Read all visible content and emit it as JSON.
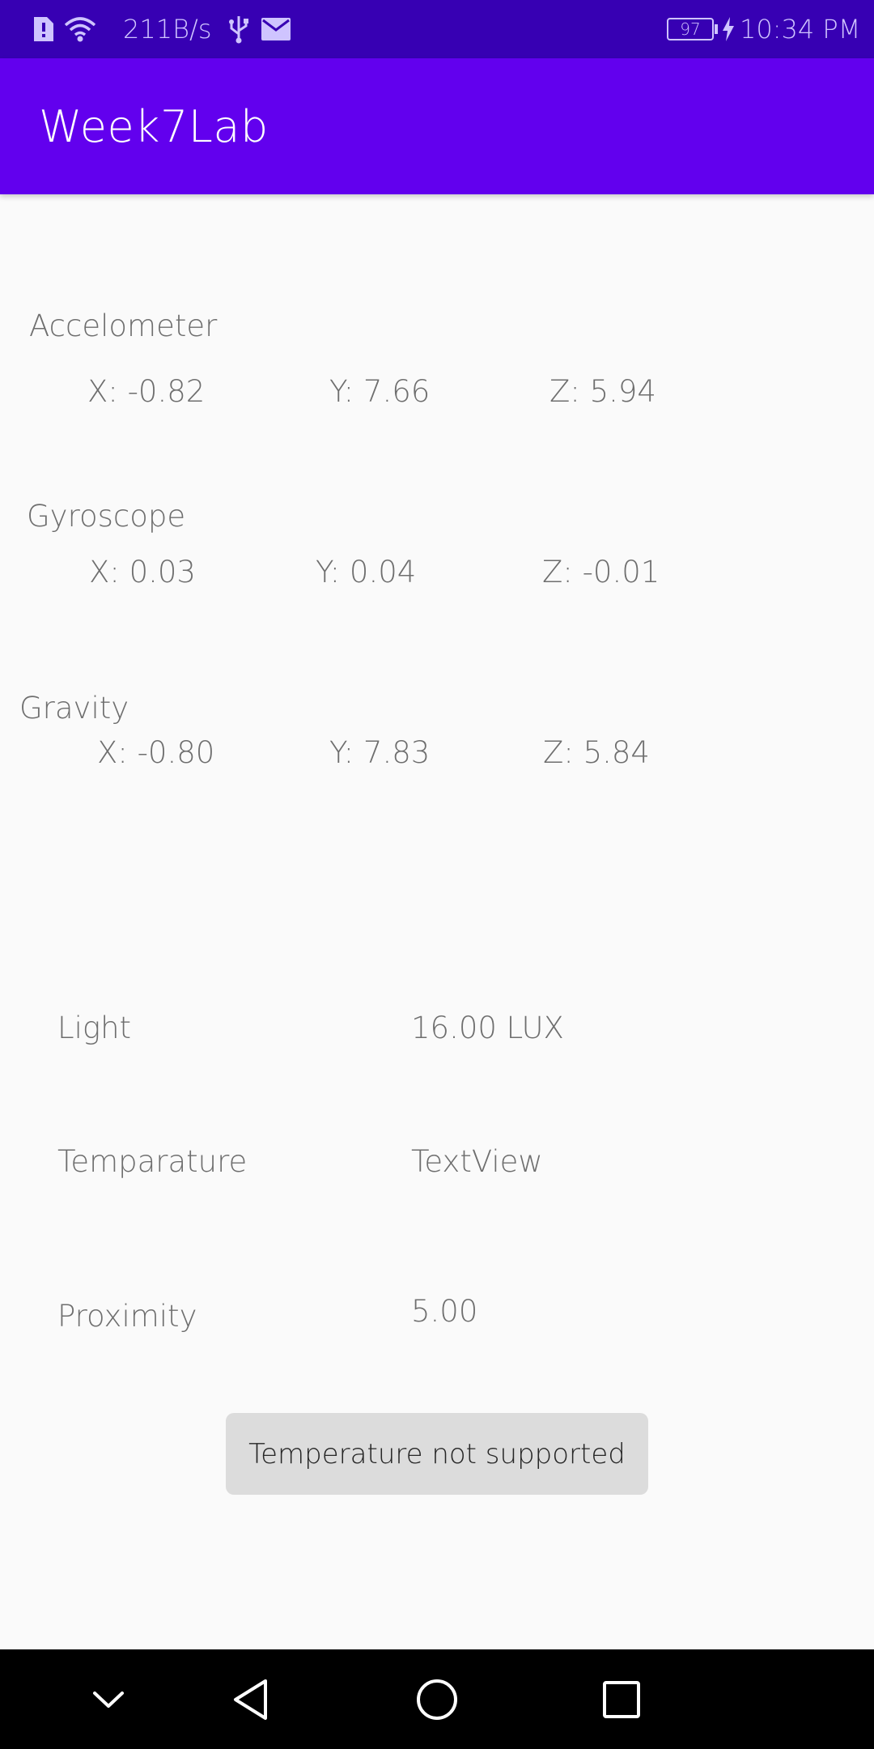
{
  "status_bar": {
    "net_speed": "211B/s",
    "battery_level": "97",
    "time": "10:34 PM",
    "icons": [
      "sim-icon",
      "wifi-icon",
      "usb-icon",
      "mail-icon",
      "battery-icon",
      "charging-icon"
    ]
  },
  "app_bar": {
    "title": "Week7Lab"
  },
  "motion_sensors": {
    "accelerometer": {
      "label": "Accelometer",
      "x": "X: -0.82",
      "y": "Y: 7.66",
      "z": "Z: 5.94"
    },
    "gyroscope": {
      "label": "Gyroscope",
      "x": "X: 0.03",
      "y": "Y: 0.04",
      "z": "Z: -0.01"
    },
    "gravity": {
      "label": "Gravity",
      "x": "X: -0.80",
      "y": "Y: 7.83",
      "z": "Z: 5.84"
    }
  },
  "environment_sensors": {
    "light": {
      "label": "Light",
      "value": "16.00 LUX"
    },
    "temperature": {
      "label": "Temparature",
      "value": "TextView"
    },
    "proximity": {
      "label": "Proximity",
      "value": "5.00"
    }
  },
  "toast": {
    "message": "Temperature not supported"
  },
  "nav_bar": {
    "icons": [
      "chevron-down-icon",
      "back-icon",
      "home-icon",
      "recents-icon"
    ]
  }
}
